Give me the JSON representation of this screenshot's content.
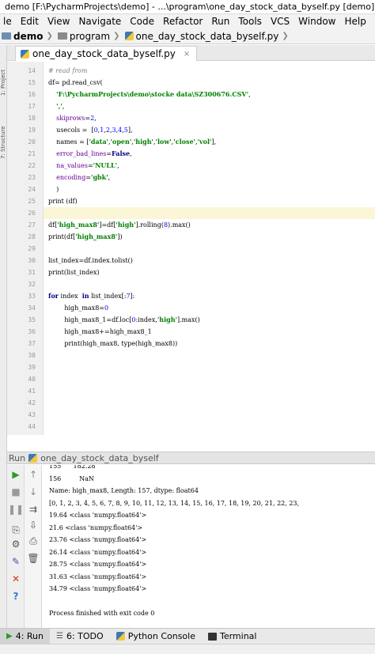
{
  "window": {
    "title": "demo [F:\\PycharmProjects\\demo] - ...\\program\\one_day_stock_data_byself.py [demo] - PyCharm"
  },
  "menu": [
    "le",
    "Edit",
    "View",
    "Navigate",
    "Code",
    "Refactor",
    "Run",
    "Tools",
    "VCS",
    "Window",
    "Help"
  ],
  "breadcrumb": {
    "project": "demo",
    "folder": "program",
    "file": "one_day_stock_data_byself.py"
  },
  "editor_tab": {
    "label": "one_day_stock_data_byself.py"
  },
  "side_labels": [
    "1: Project",
    "7: Structure"
  ],
  "code_lines": [
    {
      "n": "14",
      "text": "# read from"
    },
    {
      "n": "15",
      "text": "df= pd.read_csv("
    },
    {
      "n": "16",
      "text": "    'F:\\PycharmProjects\\demo\\stocke data\\SZ300676.CSV',"
    },
    {
      "n": "17",
      "text": "    ',',"
    },
    {
      "n": "18",
      "text": "    skiprows=2,"
    },
    {
      "n": "19",
      "text": "    usecols =  [0,1,2,3,4,5],"
    },
    {
      "n": "20",
      "text": "    names = ['data','open','high','low','close','vol'],"
    },
    {
      "n": "21",
      "text": "    error_bad_lines=False,"
    },
    {
      "n": "22",
      "text": "    na_values='NULL',"
    },
    {
      "n": "23",
      "text": "    encoding='gbk',"
    },
    {
      "n": "24",
      "text": "    )"
    },
    {
      "n": "25",
      "text": "print (df)"
    },
    {
      "n": "26",
      "text": ""
    },
    {
      "n": "27",
      "text": "df['high_max8']=df['high'].rolling(8).max()"
    },
    {
      "n": "28",
      "text": "print(df['high_max8'])"
    },
    {
      "n": "29",
      "text": ""
    },
    {
      "n": "30",
      "text": "list_index=df.index.tolist()"
    },
    {
      "n": "31",
      "text": "print(list_index)"
    },
    {
      "n": "32",
      "text": ""
    },
    {
      "n": "33",
      "text": "for index  in list_index[:7]:"
    },
    {
      "n": "34",
      "text": "        high_max8=0"
    },
    {
      "n": "35",
      "text": "        high_max8_1=df.loc[0:index,'high'].max()"
    },
    {
      "n": "36",
      "text": "        high_max8+=high_max8_1"
    },
    {
      "n": "37",
      "text": "        print(high_max8, type(high_max8))"
    },
    {
      "n": "38",
      "text": ""
    },
    {
      "n": "39",
      "text": ""
    },
    {
      "n": "40",
      "text": ""
    },
    {
      "n": "41",
      "text": ""
    },
    {
      "n": "42",
      "text": ""
    },
    {
      "n": "43",
      "text": ""
    },
    {
      "n": "44",
      "text": ""
    }
  ],
  "run_panel": {
    "label": "Run",
    "config": "one_day_stock_data_byself"
  },
  "console_lines": [
    "155      182.28",
    "156         NaN",
    "Name: high_max8, Length: 157, dtype: float64",
    "[0, 1, 2, 3, 4, 5, 6, 7, 8, 9, 10, 11, 12, 13, 14, 15, 16, 17, 18, 19, 20, 21, 22, 23,",
    "19.64 <class 'numpy.float64'>",
    "21.6 <class 'numpy.float64'>",
    "23.76 <class 'numpy.float64'>",
    "26.14 <class 'numpy.float64'>",
    "28.75 <class 'numpy.float64'>",
    "31.63 <class 'numpy.float64'>",
    "34.79 <class 'numpy.float64'>",
    "",
    "Process finished with exit code 0"
  ],
  "bottom_tabs": [
    {
      "key": "4",
      "label": "4: Run"
    },
    {
      "key": "6",
      "label": "6: TODO"
    },
    {
      "key": "py",
      "label": "Python Console"
    },
    {
      "key": "term",
      "label": "Terminal"
    }
  ],
  "colors": {
    "keyword": "#000080",
    "string": "#008000",
    "number": "#0000ff",
    "run_green": "#2b9a2b",
    "stop_red": "#d9322b"
  }
}
